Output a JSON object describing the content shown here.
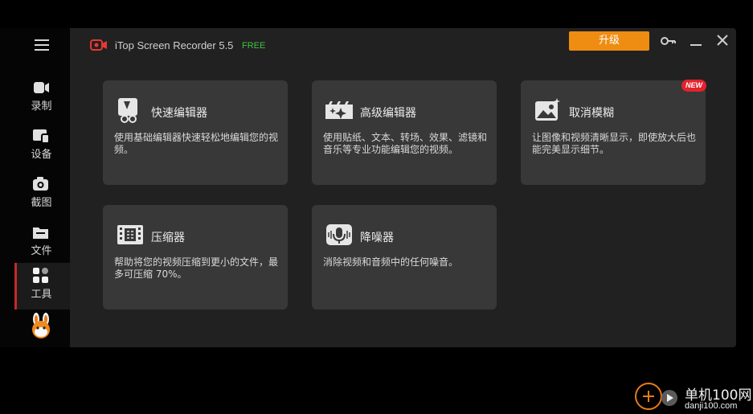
{
  "app": {
    "title": "iTop Screen Recorder 5.5",
    "edition": "FREE",
    "upgrade_label": "升级"
  },
  "colors": {
    "accent_orange": "#ef8c12",
    "free_green": "#41c241",
    "active_red": "#c62828",
    "new_badge_red": "#e3222d",
    "card_bg": "#383838",
    "window_bg": "#212121"
  },
  "sidebar": {
    "items": [
      {
        "label": "录制",
        "icon": "camera-record-icon"
      },
      {
        "label": "设备",
        "icon": "device-icon"
      },
      {
        "label": "截图",
        "icon": "screenshot-camera-icon"
      },
      {
        "label": "文件",
        "icon": "folder-icon"
      },
      {
        "label": "工具",
        "icon": "tools-grid-icon",
        "active": true
      }
    ]
  },
  "tools": [
    {
      "title": "快速编辑器",
      "desc": "使用基础编辑器快速轻松地编辑您的视频。",
      "icon": "quick-editor-icon"
    },
    {
      "title": "高级编辑器",
      "desc": "使用贴纸、文本、转场、效果、滤镜和音乐等专业功能编辑您的视频。",
      "icon": "advanced-editor-icon"
    },
    {
      "title": "取消模糊",
      "desc": "让图像和视频清晰显示，即使放大后也能完美显示细节。",
      "icon": "unblur-icon",
      "badge": "NEW"
    },
    {
      "title": "压缩器",
      "desc": "帮助将您的视频压缩到更小的文件，最多可压缩 70%。",
      "icon": "compressor-icon"
    },
    {
      "title": "降噪器",
      "desc": "消除视频和音频中的任何噪音。",
      "icon": "noise-reducer-icon"
    }
  ],
  "watermark": {
    "name": "单机100网",
    "url": "danji100.com"
  }
}
